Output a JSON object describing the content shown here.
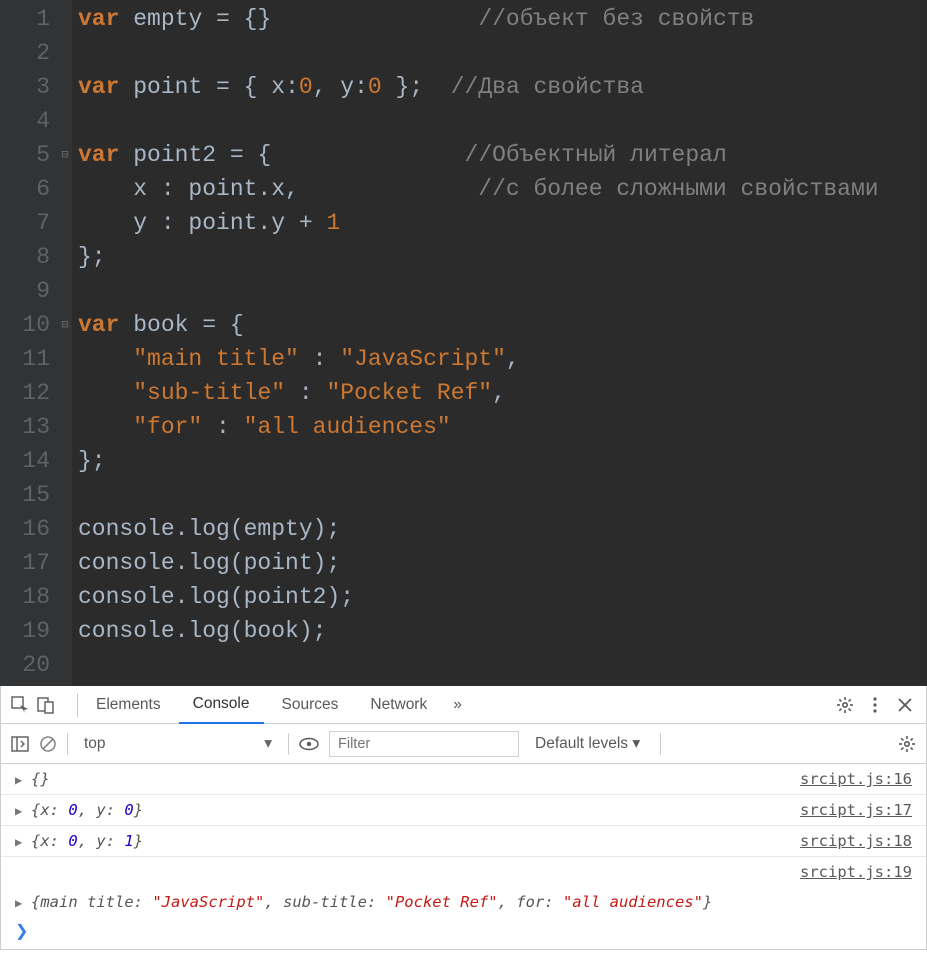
{
  "editor": {
    "line_numbers": [
      "1",
      "2",
      "3",
      "4",
      "5",
      "6",
      "7",
      "8",
      "9",
      "10",
      "11",
      "12",
      "13",
      "14",
      "15",
      "16",
      "17",
      "18",
      "19",
      "20"
    ],
    "fold_markers": {
      "5": "⊟",
      "10": "⊟"
    },
    "code_lines": [
      {
        "n": 1,
        "tokens": [
          {
            "t": "var",
            "c": "kw"
          },
          {
            "t": " ",
            "c": ""
          },
          {
            "t": "empty",
            "c": "id"
          },
          {
            "t": " = {}",
            "c": "pun"
          },
          {
            "t": "               ",
            "c": ""
          },
          {
            "t": "//объект без свойств",
            "c": "cmt"
          }
        ]
      },
      {
        "n": 2,
        "tokens": []
      },
      {
        "n": 3,
        "tokens": [
          {
            "t": "var",
            "c": "kw"
          },
          {
            "t": " ",
            "c": ""
          },
          {
            "t": "point",
            "c": "id"
          },
          {
            "t": " = { ",
            "c": "pun"
          },
          {
            "t": "x:",
            "c": "id"
          },
          {
            "t": "0",
            "c": "num"
          },
          {
            "t": ", ",
            "c": "pun"
          },
          {
            "t": "y:",
            "c": "id"
          },
          {
            "t": "0",
            "c": "num"
          },
          {
            "t": " };  ",
            "c": "pun"
          },
          {
            "t": "//Два свойства",
            "c": "cmt"
          }
        ]
      },
      {
        "n": 4,
        "tokens": []
      },
      {
        "n": 5,
        "tokens": [
          {
            "t": "var",
            "c": "kw"
          },
          {
            "t": " ",
            "c": ""
          },
          {
            "t": "point2",
            "c": "id"
          },
          {
            "t": " = {",
            "c": "pun"
          },
          {
            "t": "              ",
            "c": ""
          },
          {
            "t": "//Объектный литерал",
            "c": "cmt"
          }
        ]
      },
      {
        "n": 6,
        "tokens": [
          {
            "t": "    x : point.x,",
            "c": "id"
          },
          {
            "t": "             ",
            "c": ""
          },
          {
            "t": "//с более сложными свойствами",
            "c": "cmt"
          }
        ]
      },
      {
        "n": 7,
        "tokens": [
          {
            "t": "    y : point.y + ",
            "c": "id"
          },
          {
            "t": "1",
            "c": "num"
          }
        ]
      },
      {
        "n": 8,
        "tokens": [
          {
            "t": "};",
            "c": "pun"
          }
        ]
      },
      {
        "n": 9,
        "tokens": []
      },
      {
        "n": 10,
        "tokens": [
          {
            "t": "var",
            "c": "kw"
          },
          {
            "t": " ",
            "c": ""
          },
          {
            "t": "book",
            "c": "id"
          },
          {
            "t": " = {",
            "c": "pun"
          }
        ]
      },
      {
        "n": 11,
        "tokens": [
          {
            "t": "    ",
            "c": ""
          },
          {
            "t": "\"main title\"",
            "c": "str"
          },
          {
            "t": " : ",
            "c": "pun"
          },
          {
            "t": "\"JavaScript\"",
            "c": "str"
          },
          {
            "t": ",",
            "c": "pun"
          }
        ]
      },
      {
        "n": 12,
        "tokens": [
          {
            "t": "    ",
            "c": ""
          },
          {
            "t": "\"sub-title\"",
            "c": "str"
          },
          {
            "t": " : ",
            "c": "pun"
          },
          {
            "t": "\"Pocket Ref\"",
            "c": "str"
          },
          {
            "t": ",",
            "c": "pun"
          }
        ]
      },
      {
        "n": 13,
        "tokens": [
          {
            "t": "    ",
            "c": ""
          },
          {
            "t": "\"for\"",
            "c": "str"
          },
          {
            "t": " : ",
            "c": "pun"
          },
          {
            "t": "\"all audiences\"",
            "c": "str"
          }
        ]
      },
      {
        "n": 14,
        "tokens": [
          {
            "t": "};",
            "c": "pun"
          }
        ]
      },
      {
        "n": 15,
        "tokens": []
      },
      {
        "n": 16,
        "tokens": [
          {
            "t": "console.log(empty);",
            "c": "id"
          }
        ]
      },
      {
        "n": 17,
        "tokens": [
          {
            "t": "console.log(point);",
            "c": "id"
          }
        ]
      },
      {
        "n": 18,
        "tokens": [
          {
            "t": "console.log(point2);",
            "c": "id"
          }
        ]
      },
      {
        "n": 19,
        "tokens": [
          {
            "t": "console.log(book);",
            "c": "id"
          }
        ]
      },
      {
        "n": 20,
        "tokens": []
      }
    ]
  },
  "devtools": {
    "tabs": {
      "elements": "Elements",
      "console": "Console",
      "sources": "Sources",
      "network": "Network",
      "more": "»"
    },
    "toolbar": {
      "context": "top",
      "filter_placeholder": "Filter",
      "levels": "Default levels ▾"
    },
    "console": {
      "rows": [
        {
          "type": "object",
          "parts": [
            {
              "t": "{}",
              "c": "k"
            }
          ],
          "src": "srcipt.js:16"
        },
        {
          "type": "object",
          "parts": [
            {
              "t": "{",
              "c": "k"
            },
            {
              "t": "x: ",
              "c": "k"
            },
            {
              "t": "0",
              "c": "v-num"
            },
            {
              "t": ", ",
              "c": "k"
            },
            {
              "t": "y: ",
              "c": "k"
            },
            {
              "t": "0",
              "c": "v-num"
            },
            {
              "t": "}",
              "c": "k"
            }
          ],
          "src": "srcipt.js:17"
        },
        {
          "type": "object",
          "parts": [
            {
              "t": "{",
              "c": "k"
            },
            {
              "t": "x: ",
              "c": "k"
            },
            {
              "t": "0",
              "c": "v-num"
            },
            {
              "t": ", ",
              "c": "k"
            },
            {
              "t": "y: ",
              "c": "k"
            },
            {
              "t": "1",
              "c": "v-num"
            },
            {
              "t": "}",
              "c": "k"
            }
          ],
          "src": "srcipt.js:18"
        },
        {
          "type": "srconly",
          "src": "srcipt.js:19"
        },
        {
          "type": "object-wide",
          "parts": [
            {
              "t": "{",
              "c": "k"
            },
            {
              "t": "main title: ",
              "c": "k"
            },
            {
              "t": "\"JavaScript\"",
              "c": "v-str"
            },
            {
              "t": ", ",
              "c": "k"
            },
            {
              "t": "sub-title: ",
              "c": "k"
            },
            {
              "t": "\"Pocket Ref\"",
              "c": "v-str"
            },
            {
              "t": ", ",
              "c": "k"
            },
            {
              "t": "for: ",
              "c": "k"
            },
            {
              "t": "\"all audiences\"",
              "c": "v-str"
            },
            {
              "t": "}",
              "c": "k"
            }
          ]
        }
      ],
      "prompt": "❯"
    }
  }
}
